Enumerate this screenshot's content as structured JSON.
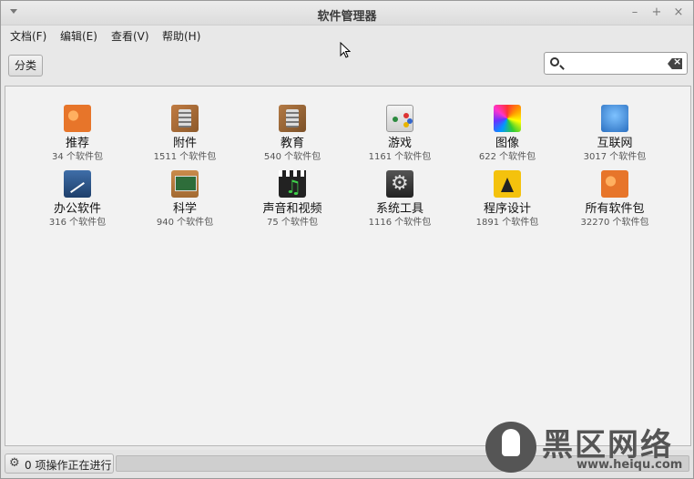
{
  "window": {
    "title": "软件管理器"
  },
  "menubar": {
    "items": [
      "文档(F)",
      "编辑(E)",
      "查看(V)",
      "帮助(H)"
    ]
  },
  "toolbar": {
    "category_button": "分类",
    "search_value": ""
  },
  "categories": [
    {
      "name": "推荐",
      "count": "34 个软件包",
      "icon": "recommend-icon"
    },
    {
      "name": "附件",
      "count": "1511 个软件包",
      "icon": "accessories-icon"
    },
    {
      "name": "教育",
      "count": "540 个软件包",
      "icon": "education-icon"
    },
    {
      "name": "游戏",
      "count": "1161 个软件包",
      "icon": "games-icon"
    },
    {
      "name": "图像",
      "count": "622 个软件包",
      "icon": "graphics-icon"
    },
    {
      "name": "互联网",
      "count": "3017 个软件包",
      "icon": "internet-icon"
    },
    {
      "name": "办公软件",
      "count": "316 个软件包",
      "icon": "office-icon"
    },
    {
      "name": "科学",
      "count": "940 个软件包",
      "icon": "science-icon"
    },
    {
      "name": "声音和视频",
      "count": "75 个软件包",
      "icon": "media-icon"
    },
    {
      "name": "系统工具",
      "count": "1116 个软件包",
      "icon": "system-icon"
    },
    {
      "name": "程序设计",
      "count": "1891 个软件包",
      "icon": "programming-icon"
    },
    {
      "name": "所有软件包",
      "count": "32270 个软件包",
      "icon": "all-packages-icon"
    }
  ],
  "statusbar": {
    "text": "0 项操作正在进行"
  },
  "watermark": {
    "text": "黑区网络",
    "url": "www.heiqu.com"
  }
}
